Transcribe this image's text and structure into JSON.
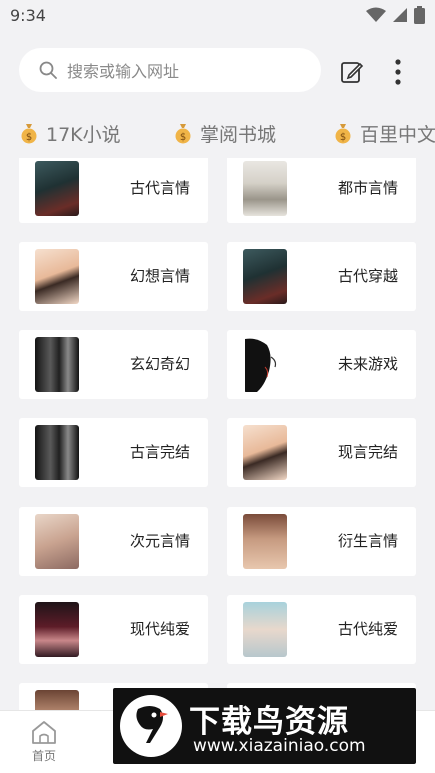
{
  "status_bar": {
    "time": "9:34",
    "icons": [
      "wifi-icon",
      "signal-icon",
      "battery-icon"
    ]
  },
  "search": {
    "placeholder": "搜索或输入网址"
  },
  "source_tabs": [
    {
      "label": "17K小说",
      "icon": "money-bag-icon"
    },
    {
      "label": "掌阅书城",
      "icon": "money-bag-icon"
    },
    {
      "label": "百里中文",
      "icon": "money-bag-icon"
    }
  ],
  "categories": [
    {
      "label": "古代言情",
      "cover": "art-dark-teal"
    },
    {
      "label": "都市言情",
      "cover": "art-pale"
    },
    {
      "label": "幻想言情",
      "cover": "art-peach"
    },
    {
      "label": "古代穿越",
      "cover": "art-dark-teal"
    },
    {
      "label": "玄幻奇幻",
      "cover": "art-bw"
    },
    {
      "label": "未来游戏",
      "cover": "art-lineart"
    },
    {
      "label": "古言完结",
      "cover": "art-bw"
    },
    {
      "label": "现言完结",
      "cover": "art-peach"
    },
    {
      "label": "次元言情",
      "cover": "art-anime-light"
    },
    {
      "label": "衍生言情",
      "cover": "art-brownhair"
    },
    {
      "label": "现代纯爱",
      "cover": "art-red"
    },
    {
      "label": "古代纯爱",
      "cover": "art-bluehair"
    },
    {
      "label": "",
      "cover": "art-face"
    },
    {
      "label": "",
      "cover": "art-pale"
    }
  ],
  "bottom_nav": {
    "home_label": "首页"
  },
  "watermark": {
    "title": "下载鸟资源",
    "url": "www.xiazainiao.com"
  },
  "colors": {
    "background": "#f2f2f4",
    "card": "#ffffff",
    "text": "#222222",
    "muted": "#777777",
    "watermark_bg": "#111111"
  }
}
